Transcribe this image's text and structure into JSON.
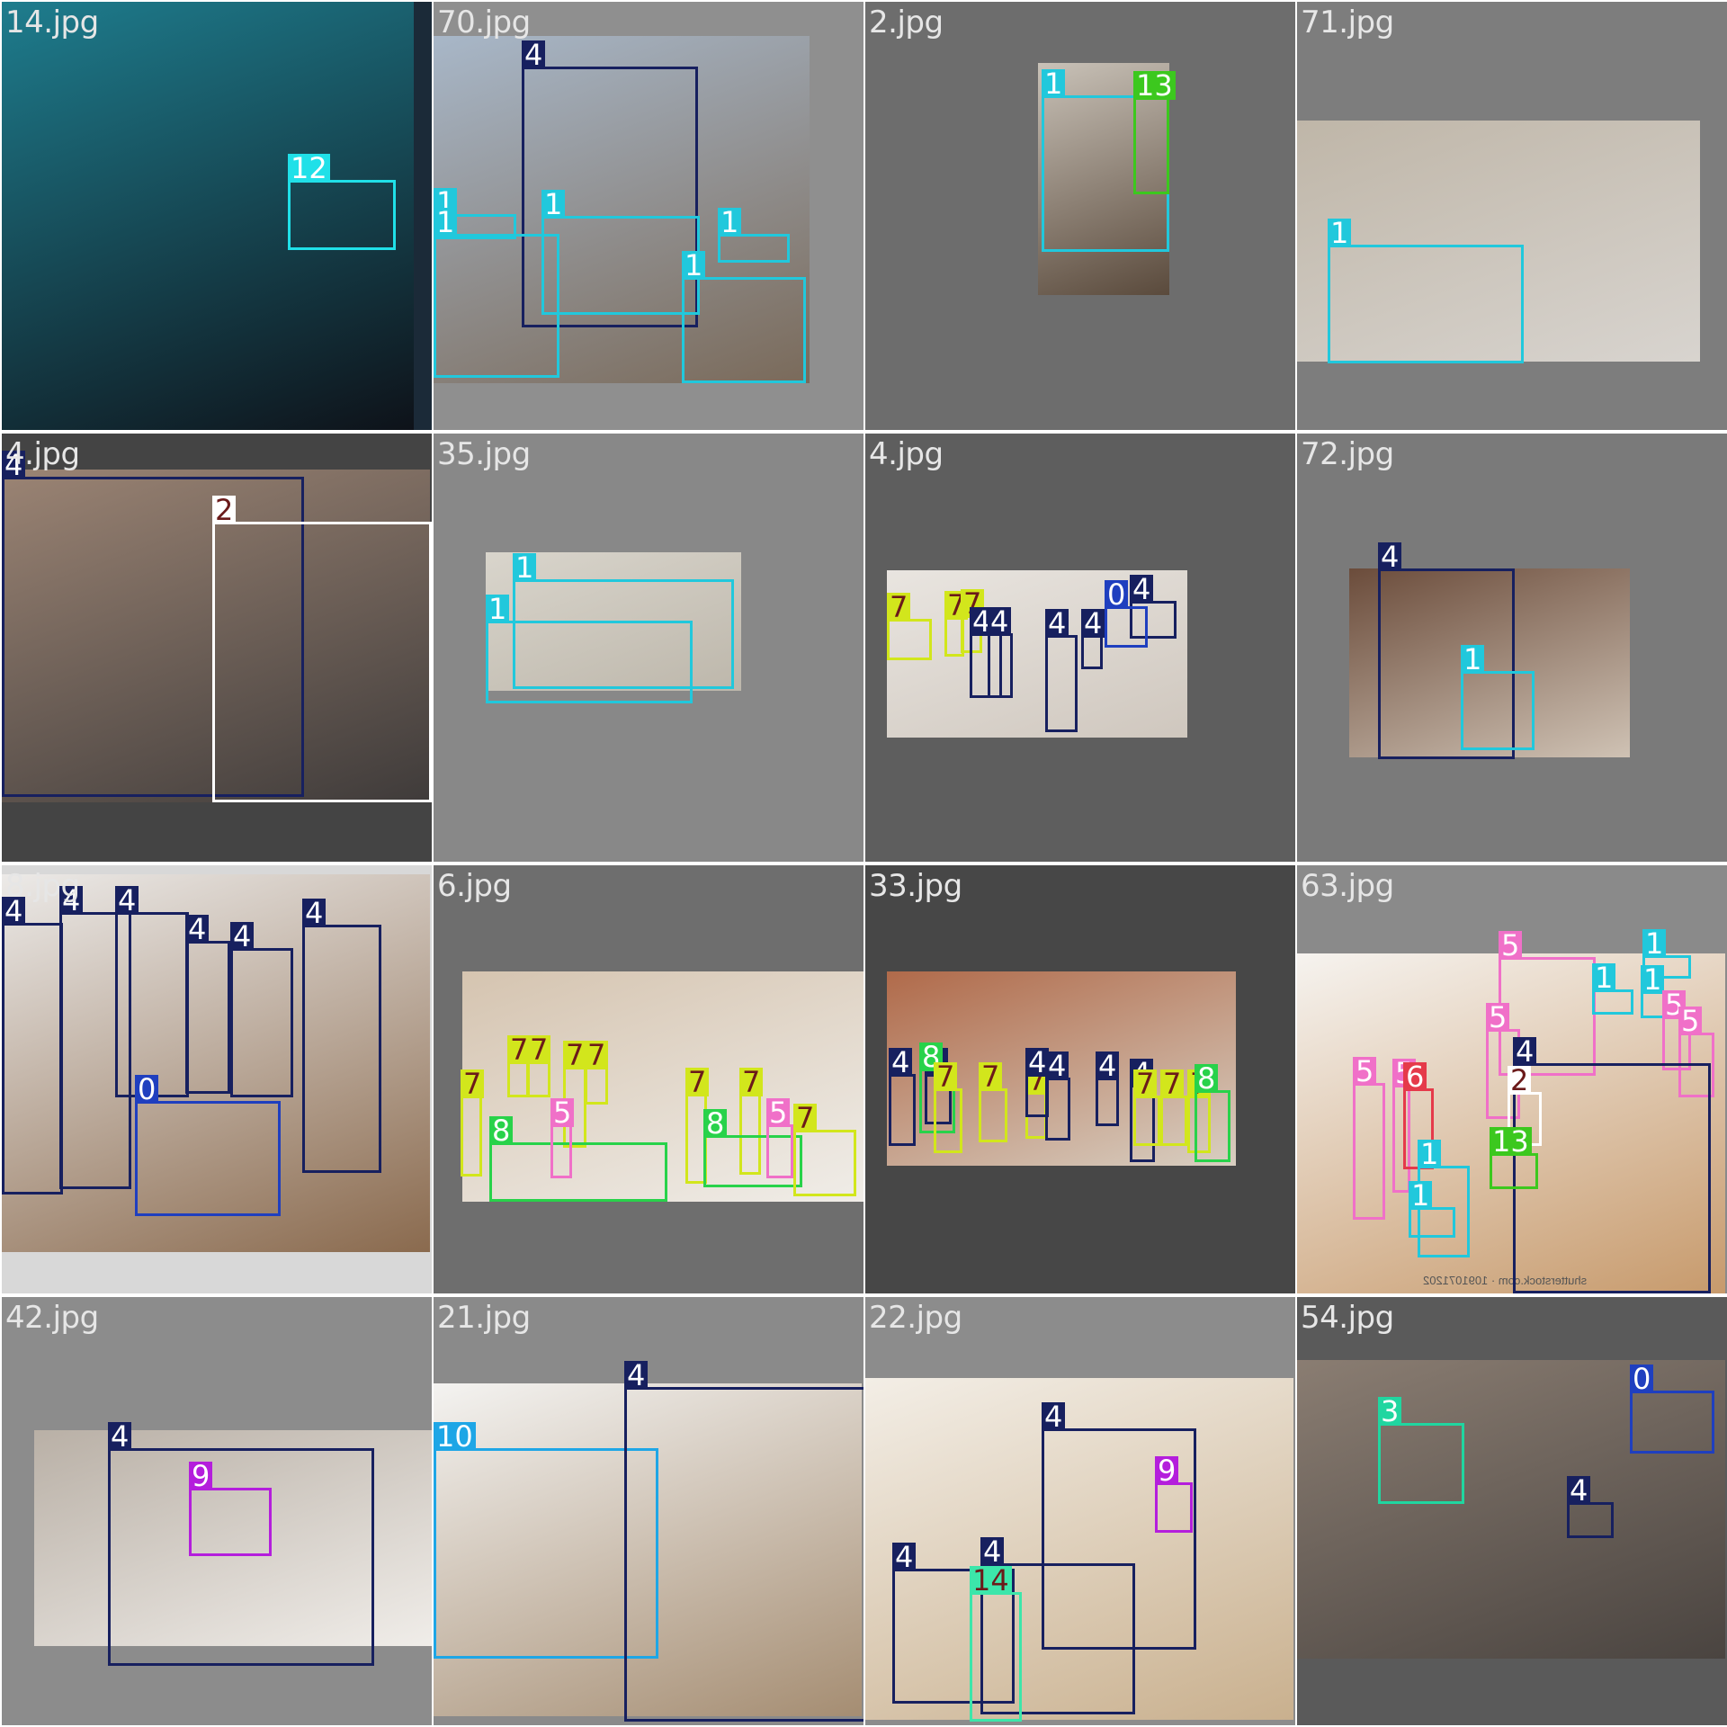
{
  "grid": {
    "columns": 4,
    "rows": 4
  },
  "class_colors": {
    "0": "#1f3fbf",
    "1": "#21c8dc",
    "2": "#ffffff",
    "3": "#20d6a0",
    "4": "#17205f",
    "5": "#f070c8",
    "6": "#e53a4a",
    "7": "#d2e61c",
    "8": "#28d24a",
    "9": "#b41edc",
    "10": "#1ea6e6",
    "12": "#20e0e8",
    "13": "#3cc81e",
    "14": "#3ce6aa"
  },
  "tiles": [
    {
      "name": "14.jpg",
      "background": "#1b2a38",
      "photo_colors": [
        "#1e7d8e",
        "#0e1219"
      ],
      "label_color": "#e6e6e6",
      "boxes": [
        {
          "cls": "12"
        }
      ]
    },
    {
      "name": "70.jpg",
      "background": "#8f8f8f",
      "photo_colors": [
        "#a8b7c8",
        "#7a6a5a"
      ],
      "label_color": "#e6e6e6",
      "boxes": [
        {
          "cls": "4"
        },
        {
          "cls": "1"
        },
        {
          "cls": "1"
        },
        {
          "cls": "1"
        },
        {
          "cls": "1"
        },
        {
          "cls": "1"
        }
      ]
    },
    {
      "name": "2.jpg",
      "background": "#6d6d6d",
      "photo_colors": [
        "#c9c2b8",
        "#5a4a3c"
      ],
      "label_color": "#e6e6e6",
      "boxes": [
        {
          "cls": "1"
        },
        {
          "cls": "13"
        }
      ]
    },
    {
      "name": "71.jpg",
      "background": "#7d7d7d",
      "photo_colors": [
        "#bfb6a8",
        "#d8d4cf"
      ],
      "label_color": "#e6e6e6",
      "boxes": [
        {
          "cls": "1"
        }
      ]
    },
    {
      "name": "4.jpg",
      "background": "#444444",
      "photo_colors": [
        "#9b8474",
        "#3f3b3a"
      ],
      "label_color": "#e6e6e6",
      "boxes": [
        {
          "cls": "4"
        },
        {
          "cls": "2"
        }
      ]
    },
    {
      "name": "35.jpg",
      "background": "#888888",
      "photo_colors": [
        "#d9d5cc",
        "#bdb7ab"
      ],
      "label_color": "#e6e6e6",
      "boxes": [
        {
          "cls": "1"
        },
        {
          "cls": "1"
        }
      ]
    },
    {
      "name": "4.jpg",
      "background": "#5e5e5e",
      "photo_colors": [
        "#e9e5e0",
        "#cfc7be"
      ],
      "label_color": "#e6e6e6",
      "boxes": [
        {
          "cls": "7"
        },
        {
          "cls": "7"
        },
        {
          "cls": "7"
        },
        {
          "cls": "4"
        },
        {
          "cls": "4"
        },
        {
          "cls": "4"
        },
        {
          "cls": "4"
        },
        {
          "cls": "4"
        },
        {
          "cls": "0"
        }
      ]
    },
    {
      "name": "72.jpg",
      "background": "#7a7a7a",
      "photo_colors": [
        "#6b4c3b",
        "#cfc2b4"
      ],
      "label_color": "#e6e6e6",
      "boxes": [
        {
          "cls": "4"
        },
        {
          "cls": "1"
        }
      ]
    },
    {
      "name": "8.jpg",
      "background": "#d8d8d8",
      "photo_colors": [
        "#eceae8",
        "#8a6a4e"
      ],
      "label_color": "#e6e6e6",
      "boxes": [
        {
          "cls": "4"
        },
        {
          "cls": "4"
        },
        {
          "cls": "4"
        },
        {
          "cls": "4"
        },
        {
          "cls": "4"
        },
        {
          "cls": "4"
        },
        {
          "cls": "0"
        }
      ]
    },
    {
      "name": "6.jpg",
      "background": "#6e6e6e",
      "photo_colors": [
        "#d5c4b0",
        "#f0ede8"
      ],
      "label_color": "#e6e6e6",
      "boxes": [
        {
          "cls": "7"
        },
        {
          "cls": "7"
        },
        {
          "cls": "7"
        },
        {
          "cls": "7"
        },
        {
          "cls": "7"
        },
        {
          "cls": "8"
        },
        {
          "cls": "5"
        },
        {
          "cls": "7"
        },
        {
          "cls": "7"
        },
        {
          "cls": "8"
        },
        {
          "cls": "5"
        },
        {
          "cls": "7"
        }
      ]
    },
    {
      "name": "33.jpg",
      "background": "#474747",
      "photo_colors": [
        "#b06a4a",
        "#d8cfc2"
      ],
      "label_color": "#e6e6e6",
      "boxes": [
        {
          "cls": "4"
        },
        {
          "cls": "4"
        },
        {
          "cls": "8"
        },
        {
          "cls": "7"
        },
        {
          "cls": "7"
        },
        {
          "cls": "7"
        },
        {
          "cls": "4"
        },
        {
          "cls": "4"
        },
        {
          "cls": "4"
        },
        {
          "cls": "4"
        },
        {
          "cls": "7"
        },
        {
          "cls": "7"
        },
        {
          "cls": "7"
        },
        {
          "cls": "8"
        }
      ]
    },
    {
      "name": "63.jpg",
      "background": "#8a8a8a",
      "photo_colors": [
        "#f6f3ef",
        "#c79a6c"
      ],
      "label_color": "#e6e6e6",
      "caption": "shutterstock.com · 1091071202",
      "boxes": [
        {
          "cls": "5"
        },
        {
          "cls": "1"
        },
        {
          "cls": "1"
        },
        {
          "cls": "1"
        },
        {
          "cls": "5"
        },
        {
          "cls": "5"
        },
        {
          "cls": "5"
        },
        {
          "cls": "4"
        },
        {
          "cls": "5"
        },
        {
          "cls": "5"
        },
        {
          "cls": "6"
        },
        {
          "cls": "2"
        },
        {
          "cls": "13"
        },
        {
          "cls": "1"
        },
        {
          "cls": "1"
        }
      ]
    },
    {
      "name": "42.jpg",
      "background": "#8c8c8c",
      "photo_colors": [
        "#b9b0a6",
        "#f0ede9"
      ],
      "label_color": "#e6e6e6",
      "boxes": [
        {
          "cls": "4"
        },
        {
          "cls": "9"
        }
      ]
    },
    {
      "name": "21.jpg",
      "background": "#8a8a8a",
      "photo_colors": [
        "#f4f3f1",
        "#a58d72"
      ],
      "label_color": "#e6e6e6",
      "boxes": [
        {
          "cls": "10"
        },
        {
          "cls": "4"
        }
      ]
    },
    {
      "name": "22.jpg",
      "background": "#8c8c8c",
      "photo_colors": [
        "#f3eee6",
        "#c9b08e"
      ],
      "label_color": "#e6e6e6",
      "boxes": [
        {
          "cls": "4"
        },
        {
          "cls": "9"
        },
        {
          "cls": "4"
        },
        {
          "cls": "4"
        },
        {
          "cls": "14"
        }
      ]
    },
    {
      "name": "54.jpg",
      "background": "#5a5a5a",
      "photo_colors": [
        "#8a7d72",
        "#4a4440"
      ],
      "label_color": "#e6e6e6",
      "boxes": [
        {
          "cls": "3"
        },
        {
          "cls": "0"
        },
        {
          "cls": "4"
        }
      ]
    }
  ]
}
